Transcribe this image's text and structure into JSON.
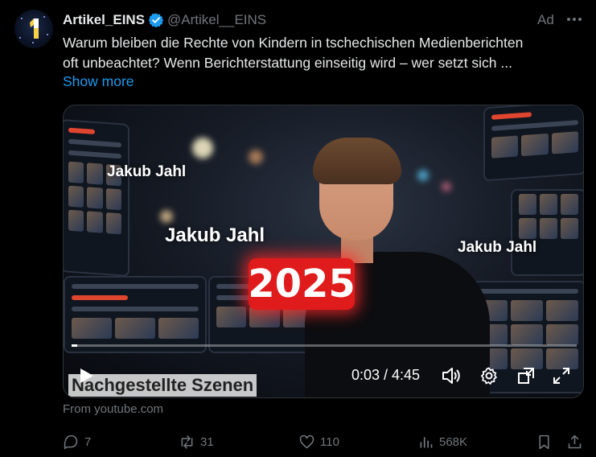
{
  "author": {
    "name": "Artikel_EINS",
    "handle": "@Artikel__EINS"
  },
  "ad_label": "Ad",
  "tweet": {
    "line1": "Warum bleiben die Rechte von Kindern in tschechischen Medienberichten",
    "line2": "oft unbeachtet? Wenn Berichterstattung einseitig wird – wer setzt sich ...",
    "show_more": "Show more"
  },
  "video": {
    "captions": [
      "Jakub Jahl",
      "Jakub Jahl",
      "Jakub Jahl"
    ],
    "year_badge": "2025",
    "scenes_label": "Nachgestellte Szenen",
    "time": "0:03 / 4:45",
    "progress": 0.011
  },
  "source": "From youtube.com",
  "stats": {
    "replies": "7",
    "reposts": "31",
    "likes": "110",
    "views": "568K"
  },
  "colors": {
    "accent": "#1d9bf0",
    "muted": "#71767b",
    "badge_red": "#e01b1b"
  }
}
